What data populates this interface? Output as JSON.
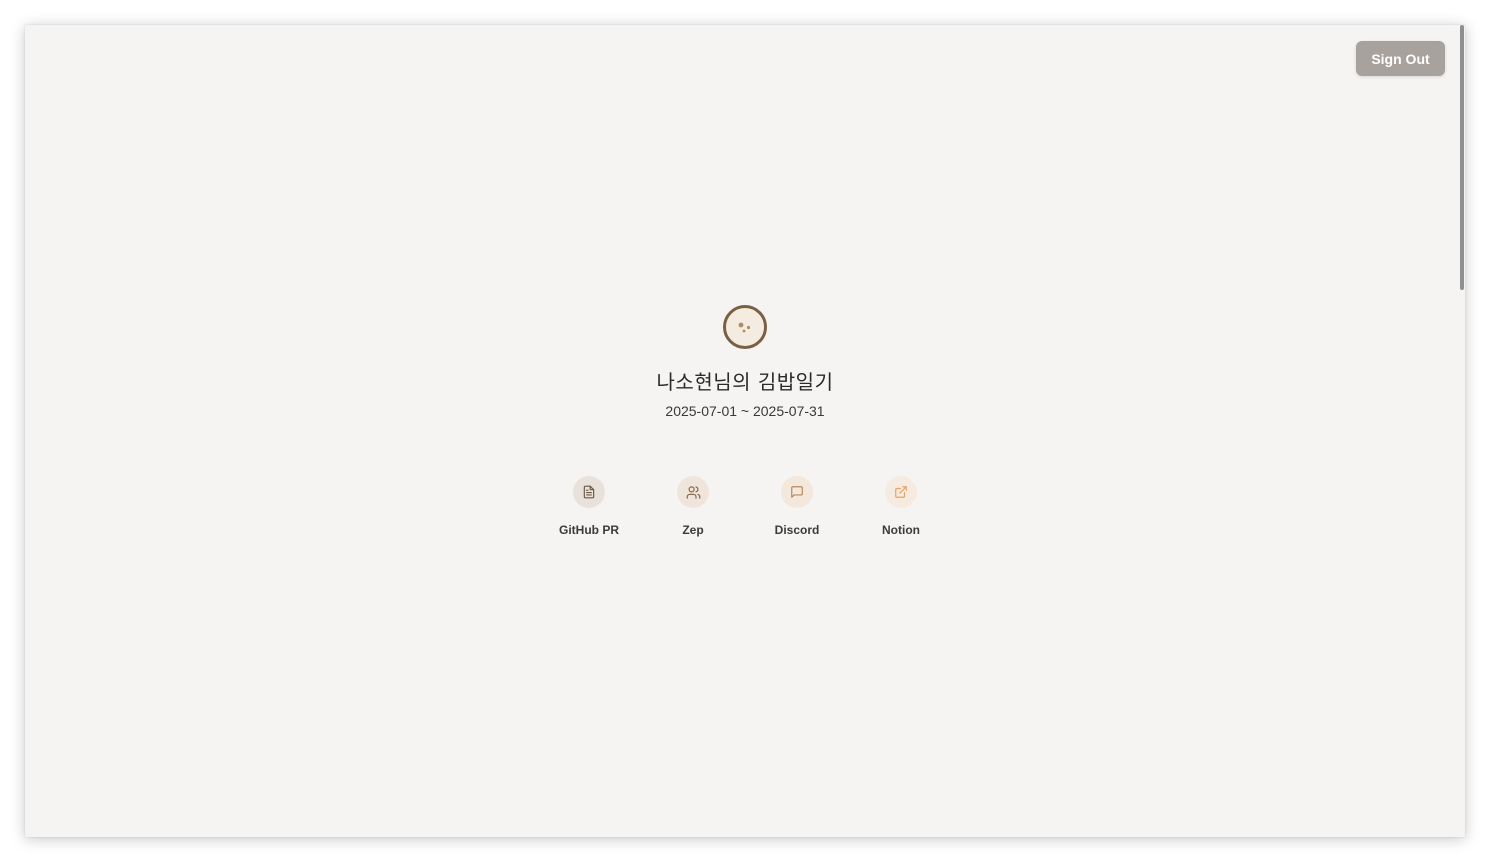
{
  "header": {
    "sign_out_label": "Sign Out"
  },
  "profile": {
    "title": "나소현님의 김밥일기",
    "date_range": "2025-07-01 ~ 2025-07-31"
  },
  "links": [
    {
      "label": "GitHub PR",
      "icon": "document-icon",
      "bg": "#e8e2db",
      "color": "#6b5a48"
    },
    {
      "label": "Zep",
      "icon": "users-icon",
      "bg": "#efe5db",
      "color": "#8a6a4c"
    },
    {
      "label": "Discord",
      "icon": "message-icon",
      "bg": "#f4e8dc",
      "color": "#b7865a"
    },
    {
      "label": "Notion",
      "icon": "external-link-icon",
      "bg": "#f6ebe0",
      "color": "#e2a26a"
    }
  ],
  "colors": {
    "background": "#f6f4f2",
    "sign_out_button": "#a8a29e",
    "avatar_border": "#7a5f43"
  }
}
